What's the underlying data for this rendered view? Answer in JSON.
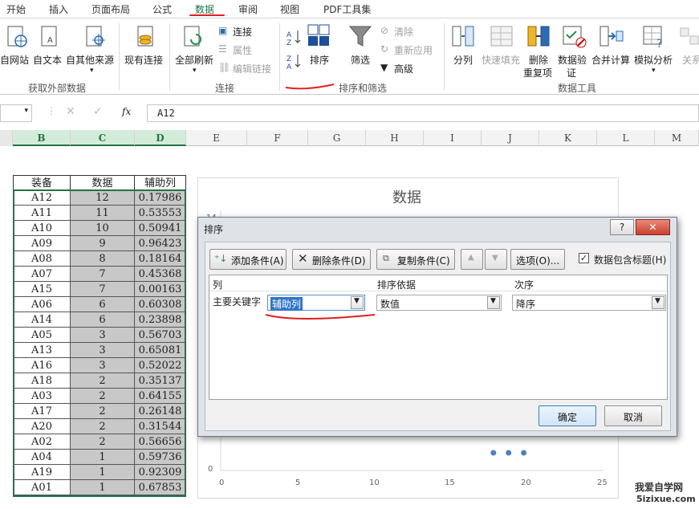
{
  "ribbon_tabs": [
    "开始",
    "插入",
    "页面布局",
    "公式",
    "数据",
    "审阅",
    "视图",
    "PDF工具集"
  ],
  "ribbon": {
    "buttons": {
      "from_web": "自网站",
      "from_text": "自文本",
      "from_other": "自其他来源",
      "existing_conn": "现有连接",
      "refresh_all": "全部刷新",
      "connections": "连接",
      "properties": "属性",
      "edit_links": "编辑链接",
      "sort": "排序",
      "filter": "筛选",
      "clear": "清除",
      "reapply": "重新应用",
      "advanced": "高级",
      "text_to_columns": "分列",
      "flash_fill": "快速填充",
      "remove_dup_1": "删除",
      "remove_dup_2": "重复项",
      "validation_1": "数据验",
      "validation_2": "证",
      "consolidate": "合并计算",
      "whatif": "模拟分析",
      "relationships": "关系"
    },
    "groups": [
      "获取外部数据",
      "连接",
      "排序和筛选",
      "数据工具"
    ]
  },
  "formula_bar": {
    "fx": "fx",
    "content": "A12"
  },
  "columns": [
    "B",
    "C",
    "D",
    "E",
    "F",
    "G",
    "H",
    "I",
    "J",
    "K",
    "L",
    "M"
  ],
  "table": {
    "headers": [
      "装备",
      "数据",
      "辅助列"
    ],
    "rows": [
      [
        "A12",
        "12",
        "0.17986"
      ],
      [
        "A11",
        "11",
        "0.53553"
      ],
      [
        "A10",
        "10",
        "0.50941"
      ],
      [
        "A09",
        "9",
        "0.96423"
      ],
      [
        "A08",
        "8",
        "0.18164"
      ],
      [
        "A07",
        "7",
        "0.45368"
      ],
      [
        "A15",
        "7",
        "0.00163"
      ],
      [
        "A06",
        "6",
        "0.60308"
      ],
      [
        "A14",
        "6",
        "0.23898"
      ],
      [
        "A05",
        "3",
        "0.56703"
      ],
      [
        "A13",
        "3",
        "0.65081"
      ],
      [
        "A16",
        "3",
        "0.52022"
      ],
      [
        "A18",
        "2",
        "0.35137"
      ],
      [
        "A03",
        "2",
        "0.64155"
      ],
      [
        "A17",
        "2",
        "0.26148"
      ],
      [
        "A20",
        "2",
        "0.31544"
      ],
      [
        "A02",
        "2",
        "0.56656"
      ],
      [
        "A04",
        "1",
        "0.59736"
      ],
      [
        "A19",
        "1",
        "0.92309"
      ],
      [
        "A01",
        "1",
        "0.67853"
      ]
    ]
  },
  "chart": {
    "title": "数据",
    "y_ticks": [
      "14",
      "0"
    ],
    "x_ticks": [
      "0",
      "5",
      "10",
      "15",
      "20",
      "25"
    ]
  },
  "chart_data": {
    "type": "scatter",
    "title": "数据",
    "xlim": [
      0,
      25
    ],
    "x_ticks": [
      0,
      5,
      10,
      15,
      20,
      25
    ],
    "visible_points": [
      {
        "x": 18,
        "y": 1
      },
      {
        "x": 19,
        "y": 1
      },
      {
        "x": 20,
        "y": 1
      }
    ]
  },
  "dialog": {
    "title": "排序",
    "help": "?",
    "close": "✕",
    "add_level": "添加条件(A)",
    "delete_level": "删除条件(D)",
    "copy_level": "复制条件(C)",
    "options": "选项(O)...",
    "has_headers": "数据包含标题(H)",
    "has_headers_checked": true,
    "col_header_column": "列",
    "col_header_sorton": "排序依据",
    "col_header_order": "次序",
    "row_label": "主要关键字",
    "sort_key": "辅助列",
    "sort_on": "数值",
    "order": "降序",
    "ok": "确定",
    "cancel": "取消"
  },
  "watermark": {
    "line1": "我爱自学网",
    "line2": "5izixue.com"
  },
  "colors": {
    "excel_green": "#217346",
    "annotation_red": "#e02020",
    "selection_gray": "#c8c8c8",
    "chart_point": "#4f81bd"
  }
}
